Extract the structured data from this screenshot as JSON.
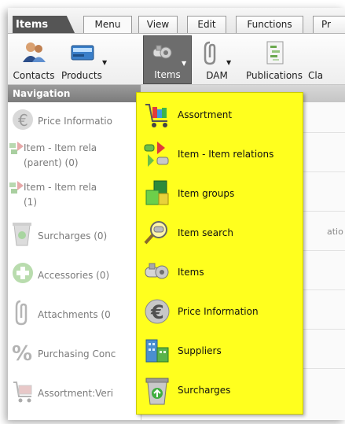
{
  "app": {
    "title": "Items"
  },
  "tabs": [
    {
      "label": "Menu",
      "active": true
    },
    {
      "label": "View",
      "active": false
    },
    {
      "label": "Edit",
      "active": false
    },
    {
      "label": "Functions",
      "active": false
    },
    {
      "label": "Pr",
      "active": false
    }
  ],
  "ribbon": [
    {
      "label": "Contacts",
      "icon": "contacts-icon",
      "dropdown": false
    },
    {
      "label": "Products",
      "icon": "products-icon",
      "dropdown": true
    },
    {
      "label": "Items",
      "icon": "items-icon",
      "dropdown": true,
      "active": true
    },
    {
      "label": "DAM",
      "icon": "dam-icon",
      "dropdown": true
    },
    {
      "label": "Publications",
      "icon": "publications-icon",
      "dropdown": false
    },
    {
      "label": "Cla",
      "icon": "",
      "dropdown": false
    }
  ],
  "navigation": {
    "header": "Navigation",
    "items": [
      {
        "label": "Price Informatio",
        "icon": "price-information-icon"
      },
      {
        "label": "Item - Item rela",
        "label2": "(parent) (0)",
        "icon": "item-relations-icon"
      },
      {
        "label": "Item - Item rela",
        "label2": "(1)",
        "icon": "item-relations-icon"
      },
      {
        "label": "Surcharges (0)",
        "icon": "surcharges-icon"
      },
      {
        "label": "Accessories (0)",
        "icon": "accessories-icon"
      },
      {
        "label": "Attachments (0",
        "icon": "attachments-icon"
      },
      {
        "label": "Purchasing Conc",
        "icon": "purchasing-conditions-icon"
      },
      {
        "label": "Assortment:Veri",
        "icon": "assortment-icon"
      }
    ]
  },
  "content": {
    "fragment": "atio"
  },
  "dropdown": {
    "items": [
      {
        "label": "Assortment",
        "icon": "assortment-icon"
      },
      {
        "label": "Item - Item relations",
        "icon": "item-relations-icon"
      },
      {
        "label": "Item groups",
        "icon": "item-groups-icon"
      },
      {
        "label": "Item search",
        "icon": "item-search-icon"
      },
      {
        "label": "Items",
        "icon": "items-icon"
      },
      {
        "label": "Price Information",
        "icon": "price-information-icon"
      },
      {
        "label": "Suppliers",
        "icon": "suppliers-icon"
      },
      {
        "label": "Surcharges",
        "icon": "surcharges-icon"
      }
    ]
  },
  "colors": {
    "dropdown_bg": "#ffff1e",
    "active_button": "#6d6d6d",
    "nav_header": "#8a8a8a"
  }
}
